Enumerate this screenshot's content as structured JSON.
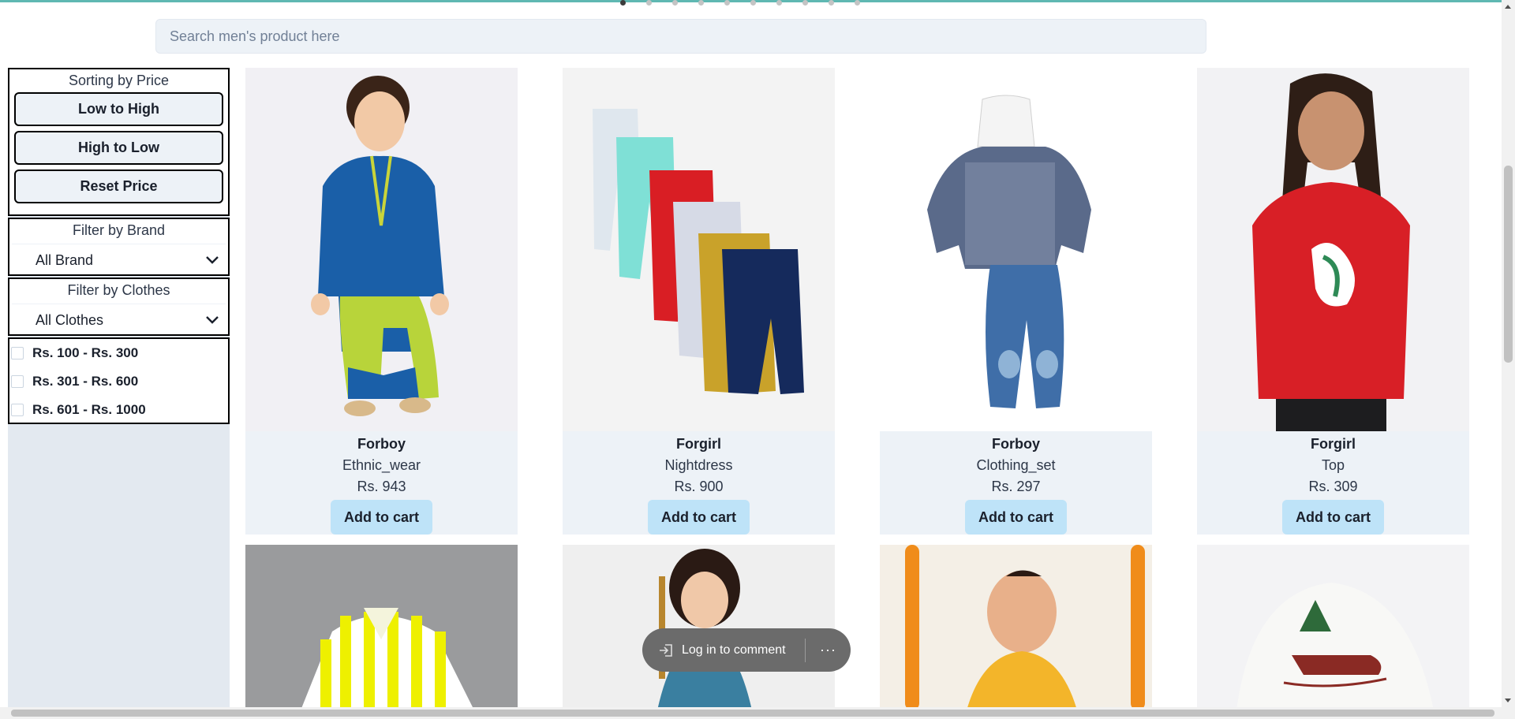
{
  "search": {
    "placeholder": "Search men's product here"
  },
  "sorting": {
    "title": "Sorting by Price",
    "low_to_high": "Low to High",
    "high_to_low": "High to Low",
    "reset": "Reset Price"
  },
  "brand_filter": {
    "title": "Filter by Brand",
    "selected": "All Brand"
  },
  "clothes_filter": {
    "title": "Filter by Clothes",
    "selected": "All Clothes"
  },
  "price_ranges": [
    {
      "label": "Rs. 100 - Rs. 300",
      "checked": false
    },
    {
      "label": "Rs. 301 - Rs. 600",
      "checked": false
    },
    {
      "label": "Rs. 601 - Rs. 1000",
      "checked": false
    }
  ],
  "products": [
    {
      "brand": "Forboy",
      "category": "Ethnic_wear",
      "price": "Rs. 943",
      "cart_label": "Add to cart",
      "image_icon": "boy-kurta-image"
    },
    {
      "brand": "Forgirl",
      "category": "Nightdress",
      "price": "Rs. 900",
      "cart_label": "Add to cart",
      "image_icon": "pajama-set-image"
    },
    {
      "brand": "Forboy",
      "category": "Clothing_set",
      "price": "Rs. 297",
      "cart_label": "Add to cart",
      "image_icon": "hoodie-jeans-image"
    },
    {
      "brand": "Forgirl",
      "category": "Top",
      "price": "Rs. 309",
      "cart_label": "Add to cart",
      "image_icon": "unicorn-top-image"
    }
  ],
  "row2_products": [
    {
      "image_icon": "striped-shirt-image"
    },
    {
      "image_icon": "girl-dress-image"
    },
    {
      "image_icon": "baby-kurta-image"
    },
    {
      "image_icon": "sleigh-sweater-image"
    }
  ],
  "comment_bar": {
    "login_label": "Log in to comment",
    "more_label": "···"
  },
  "carousel": {
    "dot_count": 10,
    "active_index": 0
  },
  "colors": {
    "accent_top": "#5fb8b2",
    "sidebar_bg": "#e3e9f0",
    "card_bg": "#edf2f7",
    "cart_button": "#bee3f8"
  }
}
